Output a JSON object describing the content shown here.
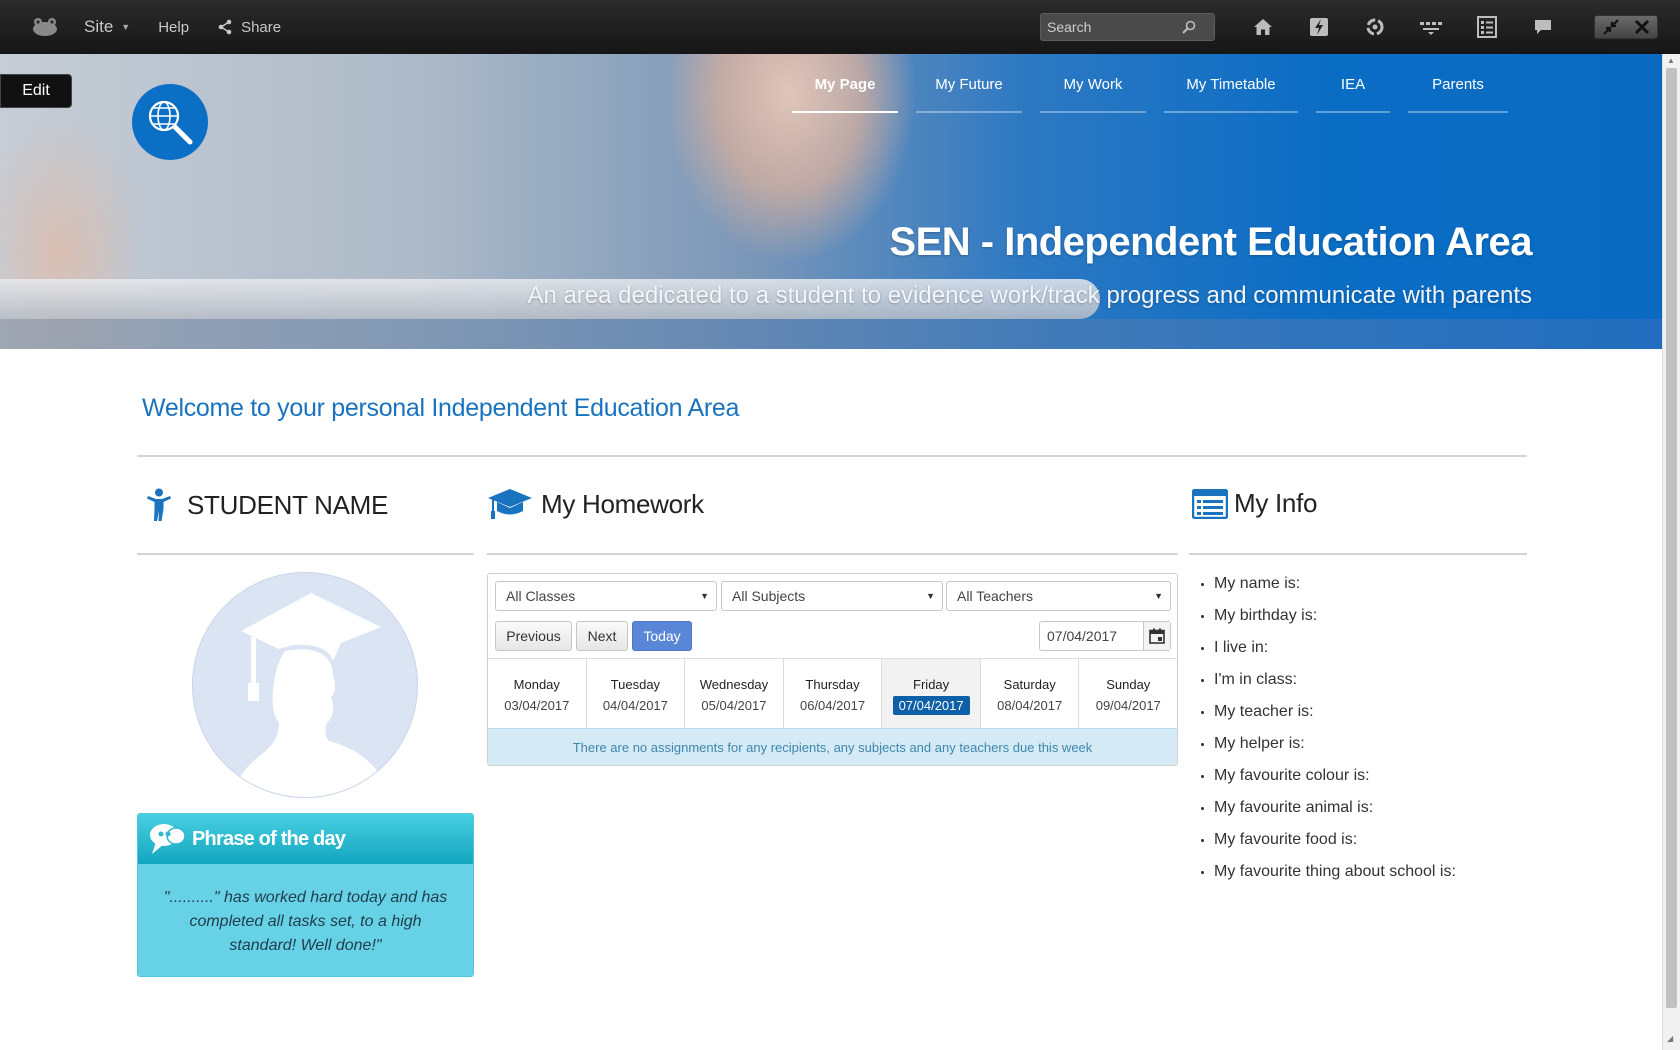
{
  "topbar": {
    "site_label": "Site",
    "help_label": "Help",
    "share_label": "Share",
    "search_placeholder": "Search",
    "icons": [
      "home-icon",
      "lightning-icon",
      "sync-icon",
      "keyboard-icon",
      "checklist-icon",
      "chat-icon"
    ]
  },
  "banner": {
    "edit_label": "Edit",
    "title": "SEN - Independent Education Area",
    "subtitle": "An area dedicated to a student to evidence work/track progress and communicate with parents",
    "nav": [
      {
        "label": "My Page",
        "active": true
      },
      {
        "label": "My Future"
      },
      {
        "label": "My Work"
      },
      {
        "label": "My Timetable"
      },
      {
        "label": "IEA"
      },
      {
        "label": "Parents"
      }
    ]
  },
  "main": {
    "welcome": "Welcome to your personal Independent Education Area",
    "student": {
      "heading": "STUDENT NAME"
    },
    "phrase": {
      "heading": "Phrase of the day",
      "text": "\"..........\" has worked hard today and has completed all tasks set, to a high standard! Well done!\""
    },
    "homework": {
      "heading": "My Homework",
      "filters": [
        "All Classes",
        "All Subjects",
        "All Teachers"
      ],
      "prev_label": "Previous",
      "next_label": "Next",
      "today_label": "Today",
      "date_value": "07/04/2017",
      "days": [
        {
          "name": "Monday",
          "date": "03/04/2017"
        },
        {
          "name": "Tuesday",
          "date": "04/04/2017"
        },
        {
          "name": "Wednesday",
          "date": "05/04/2017"
        },
        {
          "name": "Thursday",
          "date": "06/04/2017"
        },
        {
          "name": "Friday",
          "date": "07/04/2017",
          "active": true
        },
        {
          "name": "Saturday",
          "date": "08/04/2017"
        },
        {
          "name": "Sunday",
          "date": "09/04/2017"
        }
      ],
      "empty_message": "There are no assignments for any recipients, any subjects and any teachers due this week"
    },
    "info": {
      "heading": "My Info",
      "items": [
        "My name is:",
        "My birthday is:",
        "I live in:",
        "I'm in class:",
        "My teacher is:",
        "My helper is:",
        "My favourite colour is:",
        "My favourite animal is:",
        "My favourite food is:",
        "My favourite thing about school is:"
      ]
    }
  },
  "colors": {
    "accent_blue": "#1a73be",
    "today_button": "#5a86d8",
    "phrase_bg": "#67d2e6"
  }
}
